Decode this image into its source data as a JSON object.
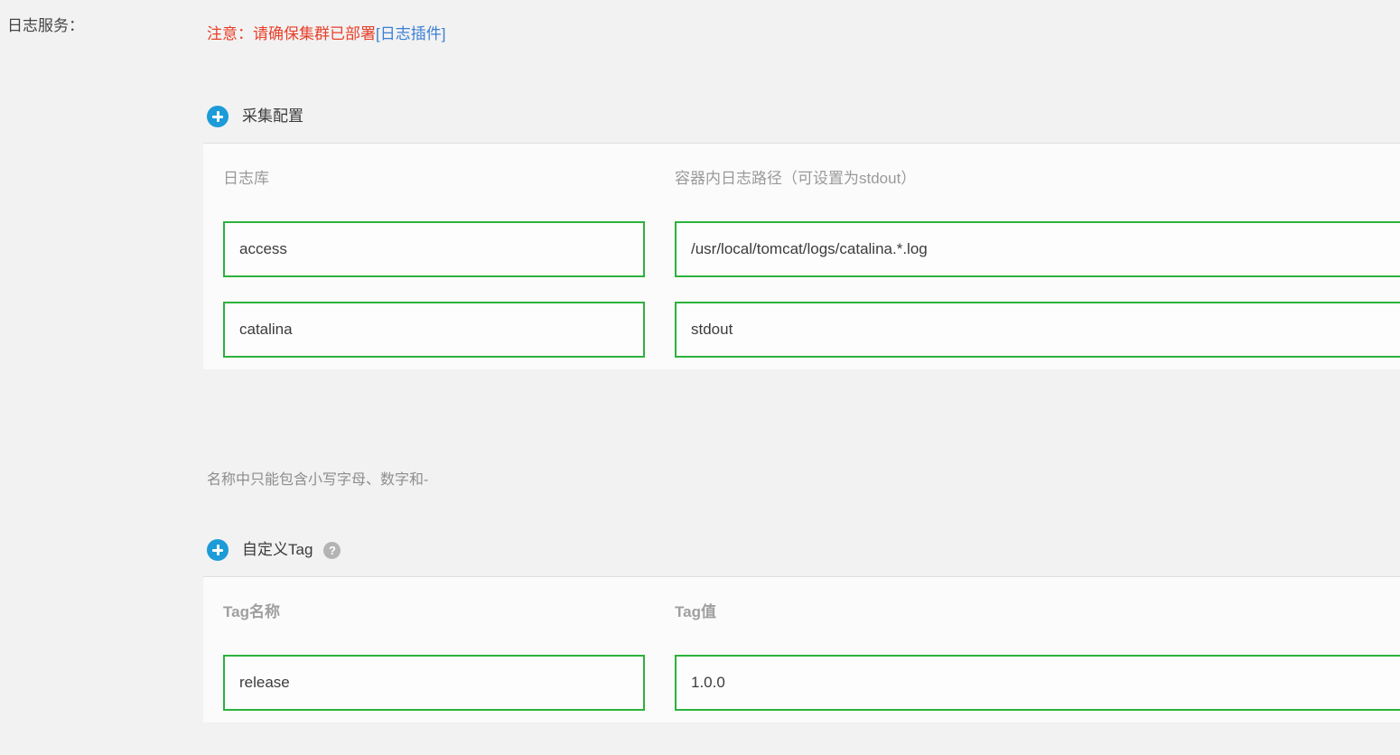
{
  "field": {
    "label": "日志服务："
  },
  "notice": {
    "text": "注意：请确保集群已部署",
    "link_text": "[日志插件]",
    "text_color": "#e8402a",
    "link_color": "#3a7fd5"
  },
  "sections": {
    "collect": {
      "add_icon": "plus-circle-icon",
      "title": "采集配置",
      "columns": [
        "日志库",
        "容器内日志路径（可设置为stdout）"
      ],
      "rows": [
        {
          "name": "access",
          "path": "/usr/local/tomcat/logs/catalina.*.log"
        },
        {
          "name": "catalina",
          "path": "stdout"
        }
      ],
      "hint": "名称中只能包含小写字母、数字和-"
    },
    "tags": {
      "add_icon": "plus-circle-icon",
      "title": "自定义Tag",
      "help_icon": "question-mark-icon",
      "help_glyph": "?",
      "columns": [
        "Tag名称",
        "Tag值"
      ],
      "rows": [
        {
          "name": "release",
          "value": "1.0.0"
        }
      ]
    }
  },
  "colors": {
    "page_background": "#f2f2f2",
    "table_background": "#fbfbfb",
    "input_border": "#2cb23c",
    "accent_blue": "#1c9bd8",
    "help_gray": "#b4b4b4"
  }
}
